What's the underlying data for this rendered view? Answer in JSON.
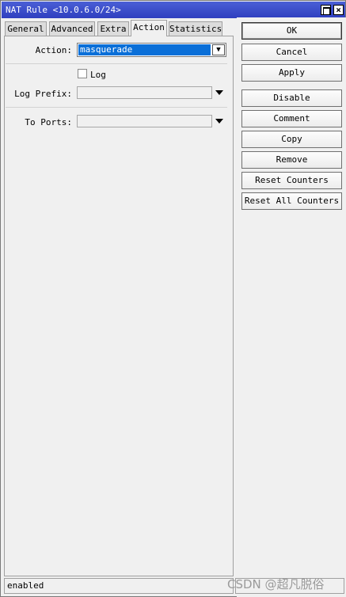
{
  "window": {
    "title": "NAT Rule <10.0.6.0/24>"
  },
  "tabs": [
    {
      "label": "General"
    },
    {
      "label": "Advanced"
    },
    {
      "label": "Extra"
    },
    {
      "label": "Action"
    },
    {
      "label": "Statistics"
    }
  ],
  "active_tab": "Action",
  "form": {
    "action_label": "Action:",
    "action_value": "masquerade",
    "log_label": "Log",
    "log_checked": false,
    "log_prefix_label": "Log Prefix:",
    "log_prefix_value": "",
    "to_ports_label": "To Ports:",
    "to_ports_value": ""
  },
  "buttons": {
    "ok": "OK",
    "cancel": "Cancel",
    "apply": "Apply",
    "disable": "Disable",
    "comment": "Comment",
    "copy": "Copy",
    "remove": "Remove",
    "reset_counters": "Reset Counters",
    "reset_all_counters": "Reset All Counters"
  },
  "status": {
    "text": "enabled"
  },
  "watermark": "CSDN @超凡脱俗",
  "icons": {
    "maximize": "maximize-icon",
    "close": "close-icon",
    "dropdown": "chevron-down-icon"
  },
  "colors": {
    "titlebar": "#3a4ccb",
    "selection": "#0a6fd8"
  }
}
